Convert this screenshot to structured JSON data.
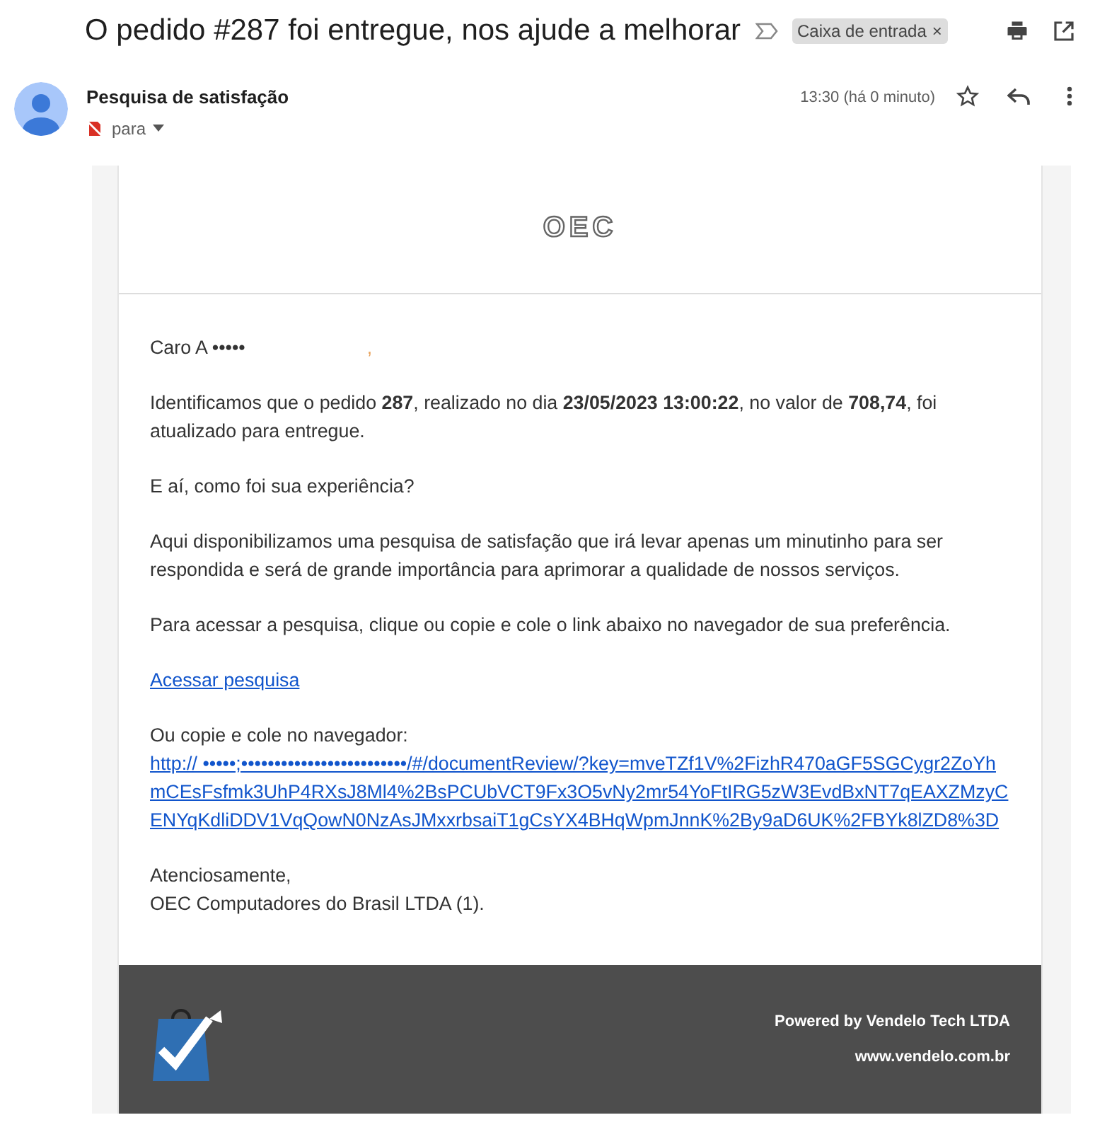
{
  "subject": "O pedido #287 foi entregue, nos ajude a melhorar",
  "label": {
    "text": "Caixa de entrada",
    "remove": "×"
  },
  "sender": {
    "name": "Pesquisa de satisfação",
    "to": "para",
    "time": "13:30 (há 0 minuto)",
    "starred": false
  },
  "email": {
    "logo": "OEC",
    "greeting": "Caro A •••••",
    "greeting_end": ",",
    "paragraphs": [
      "Identificamos que o pedido **287**, realizado no dia **23/05/2023 13:00:22**, no valor de **708,74**, foi atualizado para entregue.",
      "E aí, como foi sua experiência?",
      "Aqui disponibilizamos uma pesquisa de satisfação que irá levar apenas um minutinho para ser respondida e será de grande importância para aprimorar a qualidade de nossos serviços.",
      "Para acessar a pesquisa, clique ou copie e cole o link abaixo no navegador de sua preferência."
    ],
    "survey_link": "Acessar pesquisa",
    "copy_label": "Ou copie e cole no navegador:",
    "url": "http:// •••••;•••••••••••••••••••••••••/#/documentReview/?key=mveTZf1V%2FizhR470aGF5SGCygr2ZoYhmCEsFsfmk3UhP4RXsJ8Ml4%2BsPCUbVCT9Fx3O5vNy2mr54YoFtIRG5zW3EvdBxNT7qEAXZMzyCENYqKdliDDV1VqQowN0NzAsJMxxrbsaiT1gCsYX4BHqWpmJnnK%2By9aD6UK%2FBYk8lZD8%3D",
    "closing": "Atenciosamente,",
    "signature": "OEC Computadores do Brasil LTDA (1).",
    "footer": {
      "powered": "Powered by Vendelo Tech LTDA",
      "site": "www.vendelo.com.br"
    }
  }
}
